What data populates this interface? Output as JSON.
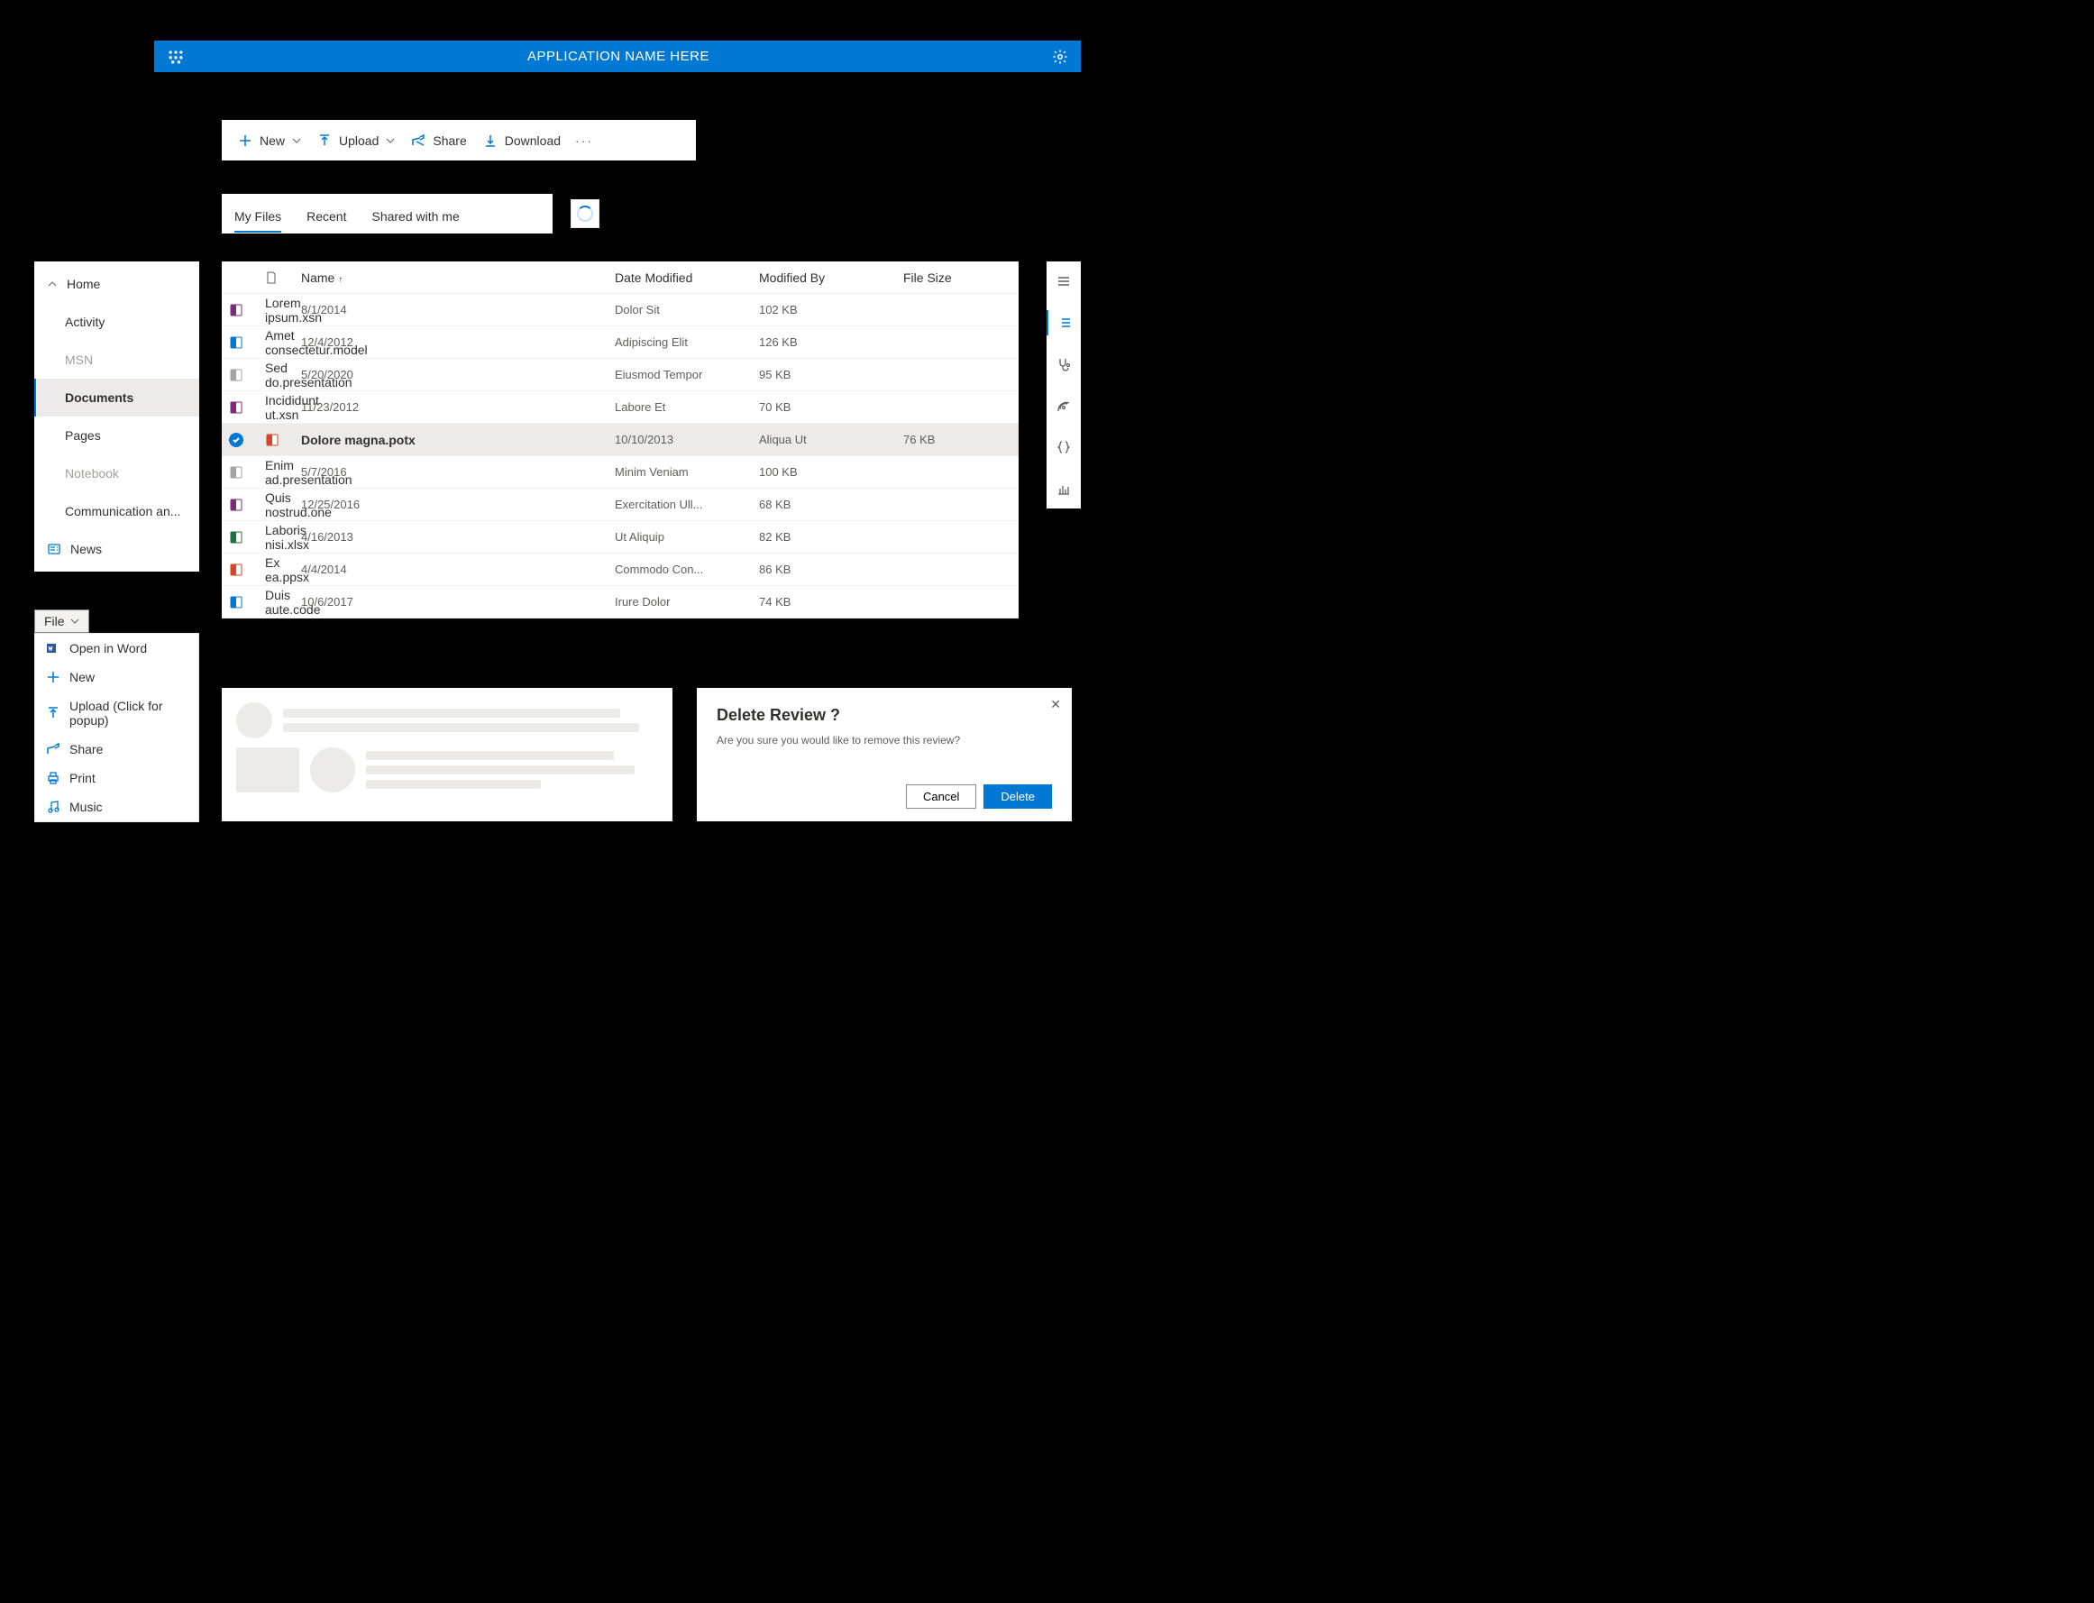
{
  "appbar": {
    "title": "APPLICATION NAME HERE"
  },
  "commandbar": {
    "new": "New",
    "upload": "Upload",
    "share": "Share",
    "download": "Download"
  },
  "tabs": {
    "items": [
      {
        "label": "My Files",
        "selected": true
      },
      {
        "label": "Recent",
        "selected": false
      },
      {
        "label": "Shared with me",
        "selected": false
      }
    ]
  },
  "nav": {
    "home": "Home",
    "items": [
      {
        "label": "Activity"
      },
      {
        "label": "MSN",
        "dim": true
      },
      {
        "label": "Documents",
        "active": true
      },
      {
        "label": "Pages"
      },
      {
        "label": "Notebook",
        "dim": true
      },
      {
        "label": "Communication an..."
      }
    ],
    "news": "News"
  },
  "table": {
    "headers": {
      "name": "Name",
      "modified": "Date Modified",
      "modifiedBy": "Modified By",
      "size": "File Size"
    },
    "rows": [
      {
        "icon": "xsn",
        "name": "Lorem ipsum.xsn",
        "modified": "8/1/2014",
        "by": "Dolor Sit",
        "size": "102 KB"
      },
      {
        "icon": "model",
        "name": "Amet consectetur.model",
        "modified": "12/4/2012",
        "by": "Adipiscing Elit",
        "size": "126 KB"
      },
      {
        "icon": "pres",
        "name": "Sed do.presentation",
        "modified": "5/20/2020",
        "by": "Eiusmod Tempor",
        "size": "95 KB"
      },
      {
        "icon": "xsn",
        "name": "Incididunt ut.xsn",
        "modified": "11/23/2012",
        "by": "Labore Et",
        "size": "70 KB"
      },
      {
        "icon": "potx",
        "name": "Dolore magna.potx",
        "modified": "10/10/2013",
        "by": "Aliqua Ut",
        "size": "76 KB",
        "selected": true
      },
      {
        "icon": "pres",
        "name": "Enim ad.presentation",
        "modified": "5/7/2016",
        "by": "Minim Veniam",
        "size": "100 KB"
      },
      {
        "icon": "one",
        "name": "Quis nostrud.one",
        "modified": "12/25/2016",
        "by": "Exercitation Ull...",
        "size": "68 KB"
      },
      {
        "icon": "xlsx",
        "name": "Laboris nisi.xlsx",
        "modified": "4/16/2013",
        "by": "Ut Aliquip",
        "size": "82 KB"
      },
      {
        "icon": "ppsx",
        "name": "Ex ea.ppsx",
        "modified": "4/4/2014",
        "by": "Commodo Con...",
        "size": "86 KB"
      },
      {
        "icon": "code",
        "name": "Duis aute.code",
        "modified": "10/6/2017",
        "by": "Irure Dolor",
        "size": "74 KB"
      }
    ]
  },
  "filemenu": {
    "button": "File",
    "items": [
      {
        "icon": "word",
        "label": "Open in Word"
      },
      {
        "icon": "plus",
        "label": "New"
      },
      {
        "icon": "upload",
        "label": "Upload (Click for popup)"
      },
      {
        "icon": "share",
        "label": "Share"
      },
      {
        "icon": "print",
        "label": "Print"
      },
      {
        "icon": "music",
        "label": "Music"
      }
    ]
  },
  "dialog": {
    "title": "Delete Review ?",
    "body": "Are you sure you would like to remove this review?",
    "cancel": "Cancel",
    "confirm": "Delete"
  }
}
